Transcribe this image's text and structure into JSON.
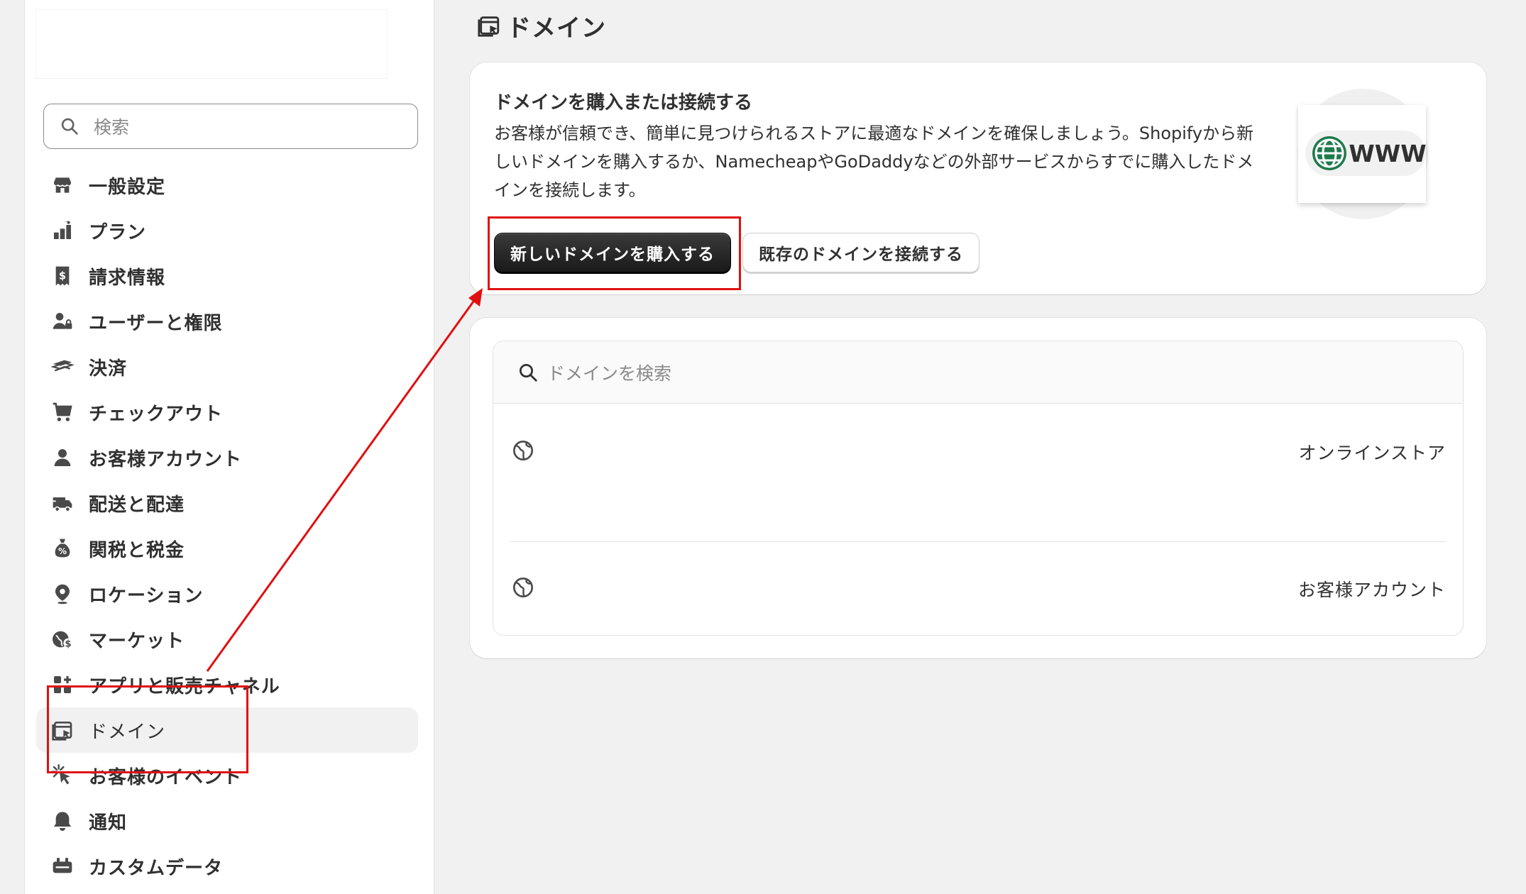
{
  "sidebar": {
    "search_placeholder": "検索",
    "items": [
      {
        "label": "一般設定",
        "icon": "store-icon"
      },
      {
        "label": "プラン",
        "icon": "plan-icon"
      },
      {
        "label": "請求情報",
        "icon": "billing-icon"
      },
      {
        "label": "ユーザーと権限",
        "icon": "users-icon"
      },
      {
        "label": "決済",
        "icon": "payments-icon"
      },
      {
        "label": "チェックアウト",
        "icon": "cart-icon"
      },
      {
        "label": "お客様アカウント",
        "icon": "person-icon"
      },
      {
        "label": "配送と配達",
        "icon": "truck-icon"
      },
      {
        "label": "関税と税金",
        "icon": "tax-icon"
      },
      {
        "label": "ロケーション",
        "icon": "location-icon"
      },
      {
        "label": "マーケット",
        "icon": "globe-dollar-icon"
      },
      {
        "label": "アプリと販売チャネル",
        "icon": "apps-icon"
      },
      {
        "label": "ドメイン",
        "icon": "domain-icon",
        "active": true
      },
      {
        "label": "お客様のイベント",
        "icon": "cursor-icon"
      },
      {
        "label": "通知",
        "icon": "bell-icon"
      },
      {
        "label": "カスタムデータ",
        "icon": "custom-data-icon"
      }
    ]
  },
  "header": {
    "title": "ドメイン"
  },
  "buy_card": {
    "heading": "ドメインを購入または接続する",
    "description": "お客様が信頼でき、簡単に見つけられるストアに最適なドメインを確保しましょう。Shopifyから新しいドメインを購入するか、NamecheapやGoDaddyなどの外部サービスからすでに購入したドメインを接続します。",
    "buy_button": "新しいドメインを購入する",
    "connect_button": "既存のドメインを接続する",
    "illustration_text": "WWW"
  },
  "domains_card": {
    "search_placeholder": "ドメインを検索",
    "rows": [
      {
        "tag": "オンラインストア"
      },
      {
        "tag": "お客様アカウント"
      }
    ]
  },
  "colors": {
    "annotation": "#e01010",
    "primary_button": "#303030",
    "globe_green": "#1f7a4d"
  }
}
